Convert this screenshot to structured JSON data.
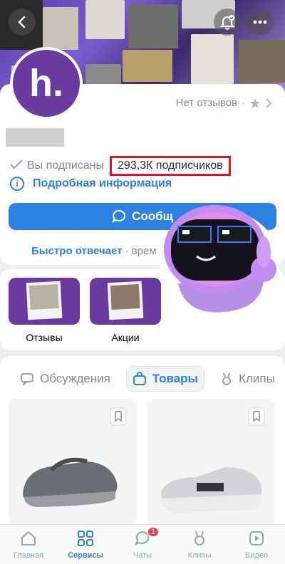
{
  "header": {
    "back_icon": "chevron-left-icon",
    "bell_icon": "bell-check-icon",
    "more_icon": "more-horizontal-icon"
  },
  "profile": {
    "avatar_letter": "h.",
    "reviews_text": "Нет отзывов",
    "subscribed_text": "Вы подписаны",
    "subscribers_text": "293,3К подписчиков",
    "details_link": "Подробная информация",
    "message_button": "Сообщ",
    "reply_fast": "Быстро отвечает",
    "reply_time": " · врем"
  },
  "stories": [
    {
      "label": "Отзывы"
    },
    {
      "label": "Акции"
    }
  ],
  "tabs": [
    {
      "label": "Обсуждения",
      "icon": "chat-icon"
    },
    {
      "label": "Товары",
      "icon": "bag-icon"
    },
    {
      "label": "Клипы",
      "icon": "clips-icon"
    }
  ],
  "nav": [
    {
      "label": "Главная",
      "icon": "home-icon"
    },
    {
      "label": "Сервисы",
      "icon": "services-icon"
    },
    {
      "label": "Чаты",
      "icon": "chats-icon",
      "badge": "1"
    },
    {
      "label": "Клипы",
      "icon": "clips-icon"
    },
    {
      "label": "Видео",
      "icon": "video-icon"
    }
  ],
  "colors": {
    "accent": "#2d81e0",
    "brand_purple": "#6a3aa0",
    "highlight_red": "#e3142a",
    "badge_red": "#e64646"
  }
}
